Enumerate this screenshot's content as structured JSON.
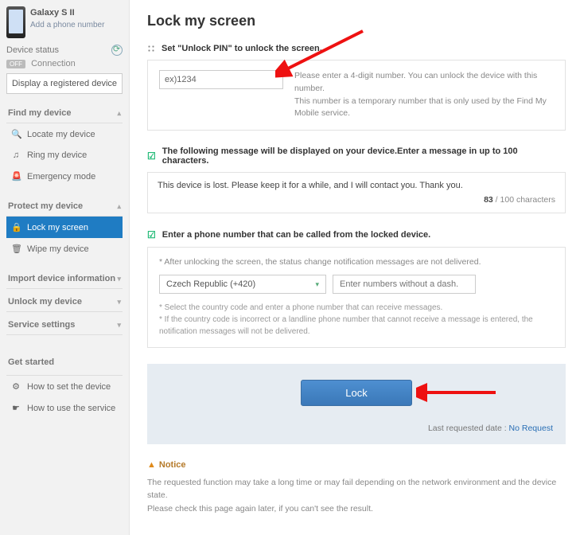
{
  "sidebar": {
    "device_name": "Galaxy S II",
    "add_phone": "Add a phone number",
    "status_label": "Device status",
    "conn_off": "OFF",
    "conn_label": "Connection",
    "reg_btn": "Display a registered device",
    "groups": {
      "find": {
        "title": "Find my device",
        "items": [
          "Locate my device",
          "Ring my device",
          "Emergency mode"
        ]
      },
      "protect": {
        "title": "Protect my device",
        "items": [
          "Lock my screen",
          "Wipe my device"
        ]
      },
      "import": {
        "title": "Import device information"
      },
      "unlock": {
        "title": "Unlock my device"
      },
      "service": {
        "title": "Service settings"
      },
      "getstarted": {
        "title": "Get started",
        "items": [
          "How to set the device",
          "How to use the service"
        ]
      }
    }
  },
  "main": {
    "title": "Lock my screen",
    "pin": {
      "head": "Set \"Unlock PIN\" to unlock the screen.",
      "value": "ex)1234",
      "hint1": "Please enter a 4-digit number. You can unlock the device with this number.",
      "hint2": "This number is a temporary number that is only used by the Find My Mobile service."
    },
    "msg": {
      "head": "The following message will be displayed on your device.Enter a message in up to 100 characters.",
      "value": "This device is lost. Please keep it for a while, and I will contact you. Thank you.",
      "count": "83",
      "max": "100",
      "unit": "characters"
    },
    "phone": {
      "head": "Enter a phone number that can be called from the locked device.",
      "notice": "* After unlocking the screen, the status change notification messages are not delivered.",
      "country": "Czech Republic (+420)",
      "num_placeholder": "Enter numbers without a dash.",
      "note1": "* Select the country code and enter a phone number that can receive messages.",
      "note2": "* If the country code is incorrect or a landline phone number that cannot receive a message is entered, the notification messages will not be delivered."
    },
    "lock": {
      "label": "Lock",
      "last_label": "Last requested date :",
      "last_value": "No Request"
    },
    "notice": {
      "head": "Notice",
      "l1": "The requested function may take a long time or may fail depending on the network environment and the device state.",
      "l2": "Please check this page again later, if you can't see the result."
    }
  }
}
